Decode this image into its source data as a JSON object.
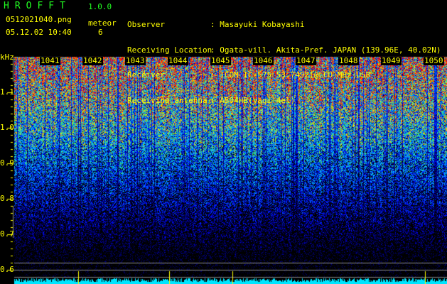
{
  "header": {
    "app_name": "HROFFT",
    "version": "1.0.0",
    "filename": "0512021040.png",
    "datetime": "05.12.02 10:40",
    "meteor_label": "meteor",
    "meteor_count": "6"
  },
  "info": [
    {
      "label": "Observer",
      "value": ": Masayuki Kobayashi"
    },
    {
      "label": "Receiving Location",
      "value": ": Ogata-vill. Akita-Pref. JAPAN (139.96E, 40.02N)"
    },
    {
      "label": "Receiver",
      "value": ": ICOM IC-575 53.7492(@LCD)MHz USB"
    },
    {
      "label": "Receiving antenna",
      "value": ": A504HB(yagi 4el)"
    }
  ],
  "y_axis": {
    "unit": "kHz",
    "ticks": [
      "1.1",
      "1.0",
      "0.9",
      "0.8",
      "0.7",
      "0.6"
    ]
  },
  "time_labels": [
    "1041",
    "1042",
    "1043",
    "1044",
    "1045",
    "1046",
    "1047",
    "1048",
    "1049",
    "1050"
  ],
  "colors": {
    "text": "#ffff00",
    "title": "#22ff22",
    "histogram": "#00e5ff"
  }
}
